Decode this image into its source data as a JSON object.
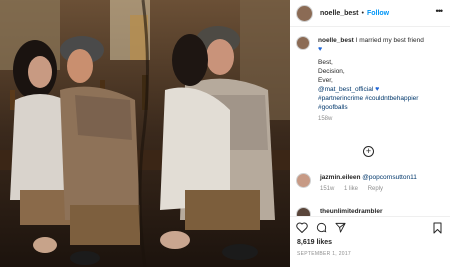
{
  "post": {
    "username": "noelle_best",
    "follow_label": "Follow",
    "separator": "•",
    "more_label": "•••"
  },
  "caption": {
    "username": "noelle_best",
    "text": "I married my best friend",
    "heart": "♥",
    "lines": [
      "Best,",
      "Decision,",
      "Ever,"
    ],
    "mention": "@mat_best_official",
    "tags_line1": "#partnerincrime #couldntbehappier",
    "tags_line2": "#goofballs",
    "time": "158w"
  },
  "load_more": "+",
  "comments": [
    {
      "username": "jazmin.eileen",
      "text": "@popcornsutton11",
      "time": "151w",
      "likes": "1 like",
      "reply": "Reply"
    },
    {
      "username": "theunlimitedrambler"
    }
  ],
  "actions": {
    "like_icon": "heart-icon",
    "comment_icon": "comment-icon",
    "share_icon": "share-icon",
    "save_icon": "bookmark-icon"
  },
  "likes_count": "8,619 likes",
  "date": "SEPTEMBER 1, 2017",
  "colors": {
    "link": "#0095f6",
    "hashtag": "#00376b",
    "muted": "#8e8e8e",
    "text": "#262626"
  }
}
